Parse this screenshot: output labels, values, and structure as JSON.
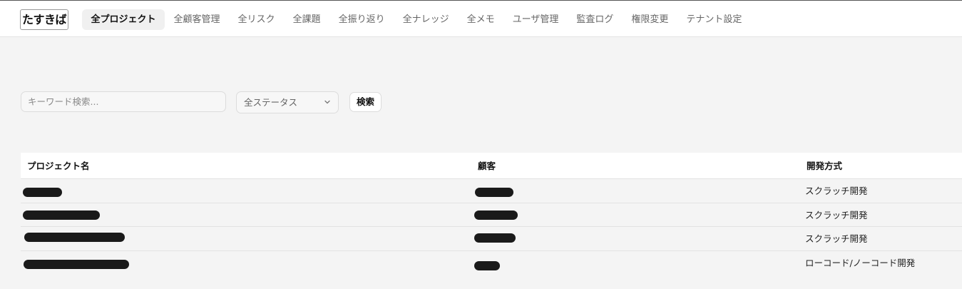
{
  "header": {
    "logo": "たすきば",
    "nav": [
      {
        "label": "全プロジェクト",
        "active": true
      },
      {
        "label": "全顧客管理"
      },
      {
        "label": "全リスク"
      },
      {
        "label": "全課題"
      },
      {
        "label": "全振り返り"
      },
      {
        "label": "全ナレッジ"
      },
      {
        "label": "全メモ"
      },
      {
        "label": "ユーザ管理"
      },
      {
        "label": "監査ログ"
      },
      {
        "label": "権限変更"
      },
      {
        "label": "テナント設定"
      }
    ]
  },
  "filters": {
    "search_placeholder": "キーワード検索...",
    "status_selected": "全ステータス",
    "search_button": "検索"
  },
  "table": {
    "columns": [
      "プロジェクト名",
      "顧客",
      "開発方式"
    ],
    "rows": [
      {
        "project": "",
        "customer": "",
        "method": "スクラッチ開発"
      },
      {
        "project": "",
        "customer": "",
        "method": "スクラッチ開発"
      },
      {
        "project": "",
        "customer": "",
        "method": "スクラッチ開発"
      },
      {
        "project": "",
        "customer": "",
        "method": "ローコード/ノーコード開発"
      }
    ]
  }
}
